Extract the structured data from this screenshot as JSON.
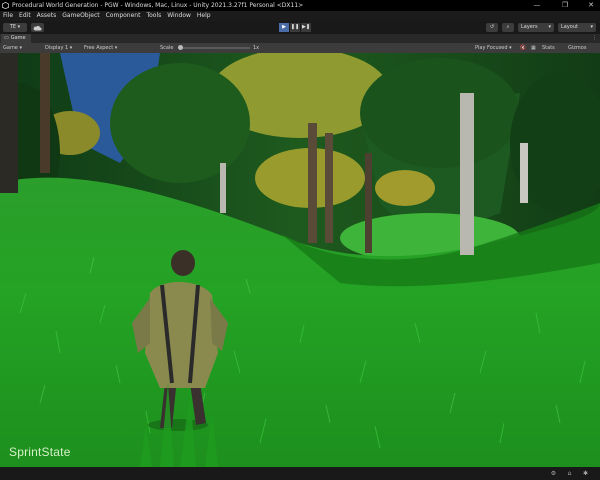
{
  "window": {
    "title": "Procedural World Generation - PGW - Windows, Mac, Linux - Unity 2021.3.27f1 Personal <DX11>",
    "controls": {
      "minimize": "—",
      "maximize": "❐",
      "close": "✕"
    }
  },
  "menu": {
    "items": [
      "File",
      "Edit",
      "Assets",
      "GameObject",
      "Component",
      "Tools",
      "Window",
      "Help"
    ]
  },
  "toolbar": {
    "account_label": "TE ▾",
    "cloud_icon": "cloud-icon",
    "play_icon": "▶",
    "pause_icon": "❚❚",
    "step_icon": "▶❚",
    "history_icon": "↺",
    "search_icon": "⌕",
    "layers_label": "Layers",
    "layout_label": "Layout"
  },
  "tab": {
    "label": "Game",
    "more": "⋮"
  },
  "gamebar": {
    "view_mode": "Game",
    "display": "Display 1",
    "aspect": "Free Aspect",
    "scale_label": "Scale",
    "scale_value": "1x",
    "play_mode": "Play Focused",
    "stats_label": "Stats",
    "gizmos_label": "Gizmos"
  },
  "viewport": {
    "state_label": "SprintState"
  },
  "colors": {
    "accent": "#4a6da8",
    "grass": "#23a523",
    "sky": "#2b4f8a"
  }
}
